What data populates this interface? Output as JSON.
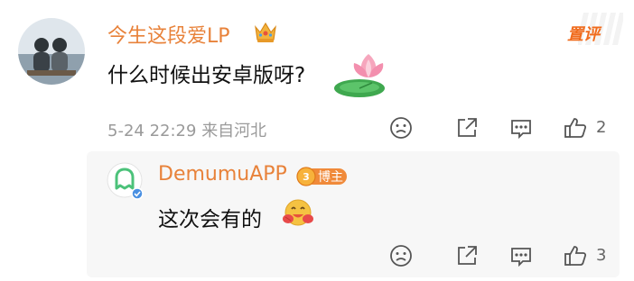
{
  "comment": {
    "username": "今生这段爱LP",
    "badge_icon": "crown-icon",
    "pin_label": "置评",
    "text": "什么时候出安卓版呀?",
    "sticker": "lotus-sticker",
    "timestamp": "5-24 22:29",
    "location": "来自河北",
    "actions": {
      "dislike_icon": "sad-face-icon",
      "share_icon": "share-icon",
      "comment_icon": "comment-icon",
      "like_icon": "thumbs-up-icon",
      "like_count": "2"
    }
  },
  "reply": {
    "username": "DemumuAPP",
    "role_badge": "博主",
    "text": "这次会有的",
    "emoji": "hug-emoji",
    "timestamp": "",
    "actions": {
      "dislike_icon": "sad-face-icon",
      "share_icon": "share-icon",
      "comment_icon": "comment-icon",
      "like_icon": "thumbs-up-icon",
      "like_count": "3"
    }
  },
  "colors": {
    "username": "#e8823a",
    "pin": "#f06b1c",
    "meta": "#9a9a9a",
    "reply_bg": "#f7f7f7",
    "avatar_green": "#4cc27a"
  }
}
